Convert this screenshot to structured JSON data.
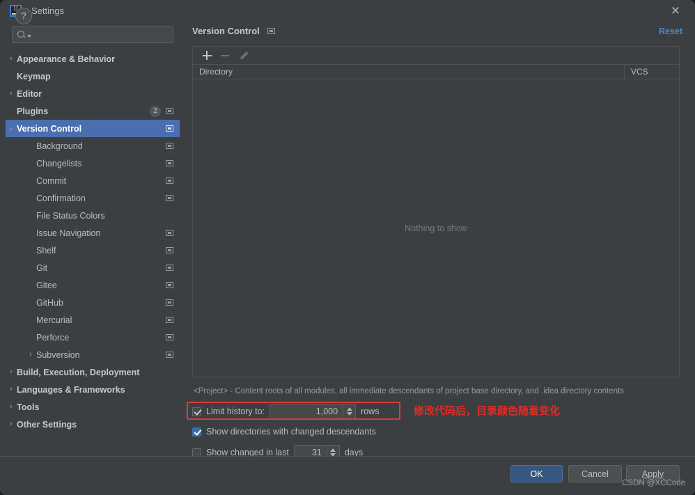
{
  "window": {
    "title": "Settings",
    "logo_icon": "intellij-idea-logo",
    "close_icon": "close-icon"
  },
  "search": {
    "value": "",
    "placeholder": "",
    "icon": "search-icon",
    "caret_icon": "chevron-down-icon"
  },
  "sidebar": {
    "items": [
      {
        "label": "Appearance & Behavior",
        "arrow": "›",
        "indent": 0,
        "bold": true,
        "selected": false,
        "mod": false,
        "badge": ""
      },
      {
        "label": "Keymap",
        "arrow": "",
        "indent": 0,
        "bold": true,
        "selected": false,
        "mod": false,
        "badge": ""
      },
      {
        "label": "Editor",
        "arrow": "›",
        "indent": 0,
        "bold": true,
        "selected": false,
        "mod": false,
        "badge": ""
      },
      {
        "label": "Plugins",
        "arrow": "",
        "indent": 0,
        "bold": true,
        "selected": false,
        "mod": true,
        "badge": "2"
      },
      {
        "label": "Version Control",
        "arrow": "⌄",
        "indent": 0,
        "bold": true,
        "selected": true,
        "mod": true,
        "badge": ""
      },
      {
        "label": "Background",
        "arrow": "",
        "indent": 1,
        "bold": false,
        "selected": false,
        "mod": true,
        "badge": ""
      },
      {
        "label": "Changelists",
        "arrow": "",
        "indent": 1,
        "bold": false,
        "selected": false,
        "mod": true,
        "badge": ""
      },
      {
        "label": "Commit",
        "arrow": "",
        "indent": 1,
        "bold": false,
        "selected": false,
        "mod": true,
        "badge": ""
      },
      {
        "label": "Confirmation",
        "arrow": "",
        "indent": 1,
        "bold": false,
        "selected": false,
        "mod": true,
        "badge": ""
      },
      {
        "label": "File Status Colors",
        "arrow": "",
        "indent": 1,
        "bold": false,
        "selected": false,
        "mod": false,
        "badge": ""
      },
      {
        "label": "Issue Navigation",
        "arrow": "",
        "indent": 1,
        "bold": false,
        "selected": false,
        "mod": true,
        "badge": ""
      },
      {
        "label": "Shelf",
        "arrow": "",
        "indent": 1,
        "bold": false,
        "selected": false,
        "mod": true,
        "badge": ""
      },
      {
        "label": "Git",
        "arrow": "",
        "indent": 1,
        "bold": false,
        "selected": false,
        "mod": true,
        "badge": ""
      },
      {
        "label": "Gitee",
        "arrow": "",
        "indent": 1,
        "bold": false,
        "selected": false,
        "mod": true,
        "badge": ""
      },
      {
        "label": "GitHub",
        "arrow": "",
        "indent": 1,
        "bold": false,
        "selected": false,
        "mod": true,
        "badge": ""
      },
      {
        "label": "Mercurial",
        "arrow": "",
        "indent": 1,
        "bold": false,
        "selected": false,
        "mod": true,
        "badge": ""
      },
      {
        "label": "Perforce",
        "arrow": "",
        "indent": 1,
        "bold": false,
        "selected": false,
        "mod": true,
        "badge": ""
      },
      {
        "label": "Subversion",
        "arrow": "›",
        "indent": 1,
        "bold": false,
        "selected": false,
        "mod": true,
        "badge": ""
      },
      {
        "label": "Build, Execution, Deployment",
        "arrow": "›",
        "indent": 0,
        "bold": true,
        "selected": false,
        "mod": false,
        "badge": ""
      },
      {
        "label": "Languages & Frameworks",
        "arrow": "›",
        "indent": 0,
        "bold": true,
        "selected": false,
        "mod": false,
        "badge": ""
      },
      {
        "label": "Tools",
        "arrow": "›",
        "indent": 0,
        "bold": true,
        "selected": false,
        "mod": false,
        "badge": ""
      },
      {
        "label": "Other Settings",
        "arrow": "›",
        "indent": 0,
        "bold": true,
        "selected": false,
        "mod": false,
        "badge": ""
      }
    ]
  },
  "panel": {
    "title": "Version Control",
    "modified_icon": "modified-marker-icon",
    "reset_label": "Reset",
    "toolbar": {
      "add_icon": "plus-icon",
      "remove_icon": "minus-icon",
      "edit_icon": "pencil-icon"
    },
    "table": {
      "columns": [
        "Directory",
        "VCS"
      ],
      "rows": [],
      "empty_text": "Nothing to show"
    },
    "project_note": "<Project> - Content roots of all modules, all immediate descendants of project base directory, and .idea directory contents",
    "options": {
      "limit_history": {
        "label": "Limit history to:",
        "checked": true,
        "value": "1,000",
        "suffix": "rows"
      },
      "show_directories": {
        "label": "Show directories with changed descendants",
        "checked": true
      },
      "show_changed_in_last": {
        "label": "Show changed in last",
        "checked": false,
        "value": "31",
        "suffix": "days"
      }
    }
  },
  "annotation": {
    "text": "修改代码后，目录颜色随着变化",
    "color": "#e32b24"
  },
  "footer": {
    "help_label": "?",
    "ok_label": "OK",
    "cancel_label": "Cancel",
    "apply_label_prefix": "A",
    "apply_label_rest": "pply",
    "watermark": "CSDN @XCCode"
  },
  "colors": {
    "window_bg": "#3c3f41",
    "selection_blue": "#4b6eaf",
    "link_blue": "#4a88c7",
    "ok_blue": "#365880",
    "annotation_red": "#e32b24"
  }
}
